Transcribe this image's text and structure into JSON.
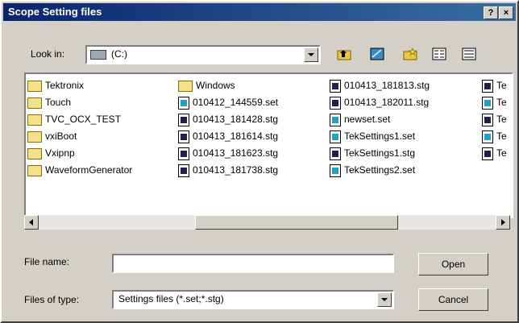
{
  "window": {
    "title": "Scope Setting files",
    "help_glyph": "?",
    "close_glyph": "×"
  },
  "lookin": {
    "label": "Look in:",
    "value": "(C:)"
  },
  "files": {
    "col1": [
      "Tektronix",
      "Touch",
      "TVC_OCX_TEST",
      "vxiBoot",
      "Vxipnp",
      "WaveformGenerator"
    ],
    "col2": [
      "Windows",
      "010412_144559.set",
      "010413_181428.stg",
      "010413_181614.stg",
      "010413_181623.stg",
      "010413_181738.stg"
    ],
    "col3": [
      "010413_181813.stg",
      "010413_182011.stg",
      "newset.set",
      "TekSettings1.set",
      "TekSettings1.stg",
      "TekSettings2.set"
    ],
    "col4": [
      "Te",
      "Te",
      "Te",
      "Te",
      "Te"
    ]
  },
  "filename": {
    "label": "File name:",
    "value": ""
  },
  "filetype": {
    "label": "Files of type:",
    "value": "Settings files (*.set;*.stg)"
  },
  "buttons": {
    "open": "Open",
    "cancel": "Cancel"
  }
}
